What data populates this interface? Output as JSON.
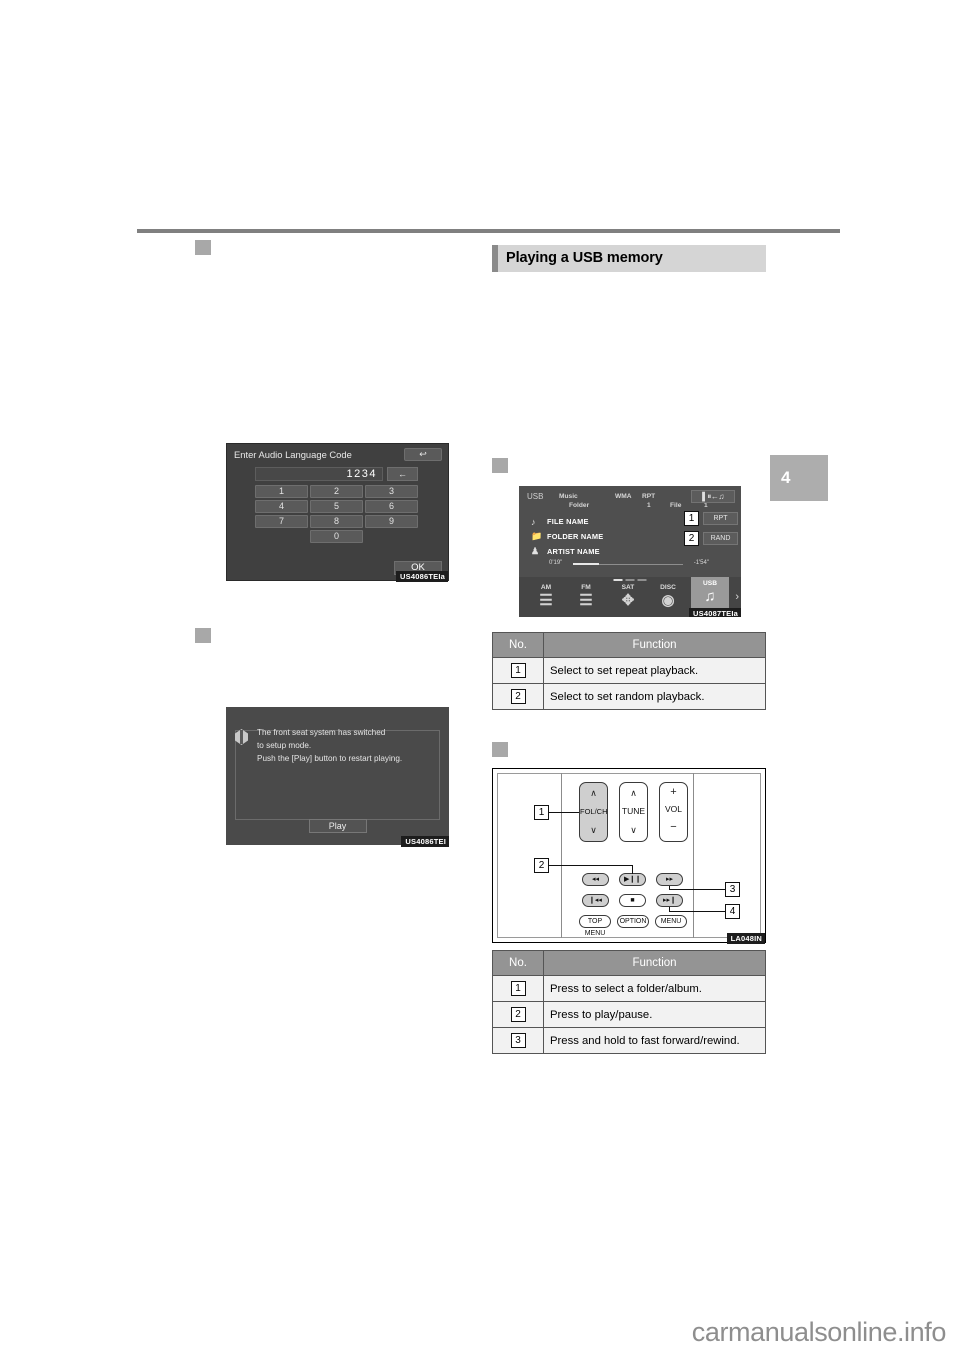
{
  "page": {
    "chapter_tab": "4",
    "watermark": "carmanualsonline.info"
  },
  "section": {
    "heading": "Playing a USB memory"
  },
  "figures": {
    "keypad": {
      "caption": "US4086TEIa",
      "title": "Enter Audio Language Code",
      "back_icon": "return-arrow-icon",
      "value": "1234",
      "delete_icon": "backspace-arrow-icon",
      "keys": [
        [
          "1",
          "2",
          "3"
        ],
        [
          "4",
          "5",
          "6"
        ],
        [
          "7",
          "8",
          "9"
        ]
      ],
      "zero_key": "0",
      "ok_label": "OK"
    },
    "message": {
      "caption": "US4086TEI",
      "icon": "info-diamond-icon",
      "lines": [
        "The front seat system has switched",
        "to setup mode.",
        "Push the [Play] button to restart playing."
      ],
      "button_label": "Play"
    },
    "usb_screen": {
      "caption": "US4087TEIa",
      "source_label": "USB",
      "status": {
        "mode_top": "Music",
        "mode_bottom": "Folder",
        "format": "WMA",
        "repeat_label": "RPT",
        "repeat_value": "1",
        "file_label": "File",
        "random_label": "RAND",
        "random_value": "1"
      },
      "headphone_icon": "headphone-mute-icon",
      "info_rows": [
        {
          "icon": "music-note-icon",
          "label": "FILE NAME"
        },
        {
          "icon": "folder-icon",
          "label": "FOLDER NAME"
        },
        {
          "icon": "artist-icon",
          "label": "ARTIST NAME"
        }
      ],
      "time_elapsed": "0'19\"",
      "time_remaining": "-1'54\"",
      "callouts": [
        {
          "number": "1",
          "label": "RPT"
        },
        {
          "number": "2",
          "label": "RAND"
        }
      ],
      "sources": [
        {
          "label": "AM",
          "icon": "radio-tower-icon"
        },
        {
          "label": "FM",
          "icon": "radio-tower-icon"
        },
        {
          "label": "SAT",
          "icon": "satellite-icon"
        },
        {
          "label": "DISC",
          "icon": "disc-icon"
        },
        {
          "label": "USB",
          "icon": "music-note-icon"
        }
      ],
      "next_icon": "chevron-right-icon"
    },
    "remote": {
      "caption": "LA048IN",
      "keys": {
        "folch": "FOL/CH",
        "tune": "TUNE",
        "vol": "VOL",
        "vol_plus": "+",
        "vol_minus": "−",
        "up_chevron": "∧",
        "down_chevron": "∨",
        "rewind": "◂◂",
        "playpause": "▶❙❙",
        "fastforward": "▸▸",
        "prev_track": "❙◂◂",
        "stop": "■",
        "next_track": "▸▸❙",
        "top_menu": "TOP MENU",
        "option": "OPTION",
        "menu": "MENU"
      },
      "callouts": [
        "1",
        "2",
        "3",
        "4"
      ]
    }
  },
  "tables": {
    "usb_screen": {
      "headers": {
        "no": "No.",
        "function": "Function"
      },
      "rows": [
        {
          "no": "1",
          "function": "Select to set repeat playback."
        },
        {
          "no": "2",
          "function": "Select to set random playback."
        }
      ]
    },
    "remote": {
      "headers": {
        "no": "No.",
        "function": "Function"
      },
      "rows": [
        {
          "no": "1",
          "function": "Press to select a folder/album."
        },
        {
          "no": "2",
          "function": "Press to play/pause."
        },
        {
          "no": "3",
          "function": "Press and hold to fast forward/rewind."
        }
      ]
    }
  }
}
